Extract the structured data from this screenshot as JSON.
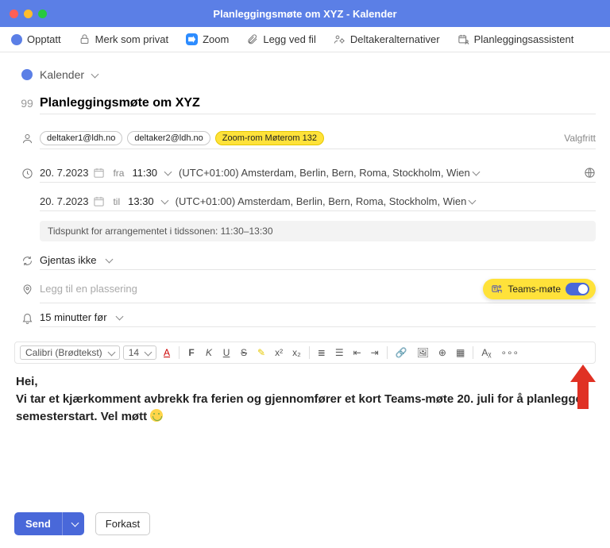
{
  "window": {
    "title": "Planleggingsmøte om XYZ - Kalender"
  },
  "toolbar": {
    "status": "Opptatt",
    "private": "Merk som privat",
    "zoom": "Zoom",
    "attach": "Legg ved fil",
    "participants": "Deltakeralternativer",
    "assistant": "Planleggingsassistent"
  },
  "form": {
    "calendar_label": "Kalender",
    "subject": "Planleggingsmøte om XYZ",
    "attendees": {
      "chips": [
        "deltaker1@ldh.no",
        "deltaker2@ldh.no"
      ],
      "room_chip": "Zoom-rom Møterom 132",
      "optional_label": "Valgfritt"
    },
    "start": {
      "date": "20. 7.2023",
      "from_label": "fra",
      "time": "11:30",
      "tz": "(UTC+01:00) Amsterdam, Berlin, Bern, Roma, Stockholm, Wien"
    },
    "end": {
      "date": "20. 7.2023",
      "to_label": "til",
      "time": "13:30",
      "tz": "(UTC+01:00) Amsterdam, Berlin, Bern, Roma, Stockholm, Wien"
    },
    "tz_banner": "Tidspunkt for arrangementet i tidssonen: 11:30–13:30",
    "recurrence": "Gjentas ikke",
    "location_placeholder": "Legg til en plassering",
    "teams_label": "Teams-møte",
    "teams_on": true,
    "reminder": "15 minutter før"
  },
  "rich": {
    "font": "Calibri (Brødtekst)",
    "size": "14"
  },
  "body": {
    "greeting": "Hei,",
    "text": "Vi tar et kjærkomment avbrekk fra ferien og gjennomfører et kort Teams-møte 20. juli for å planlegge semesterstart. Vel møtt "
  },
  "footer": {
    "send": "Send",
    "discard": "Forkast"
  }
}
